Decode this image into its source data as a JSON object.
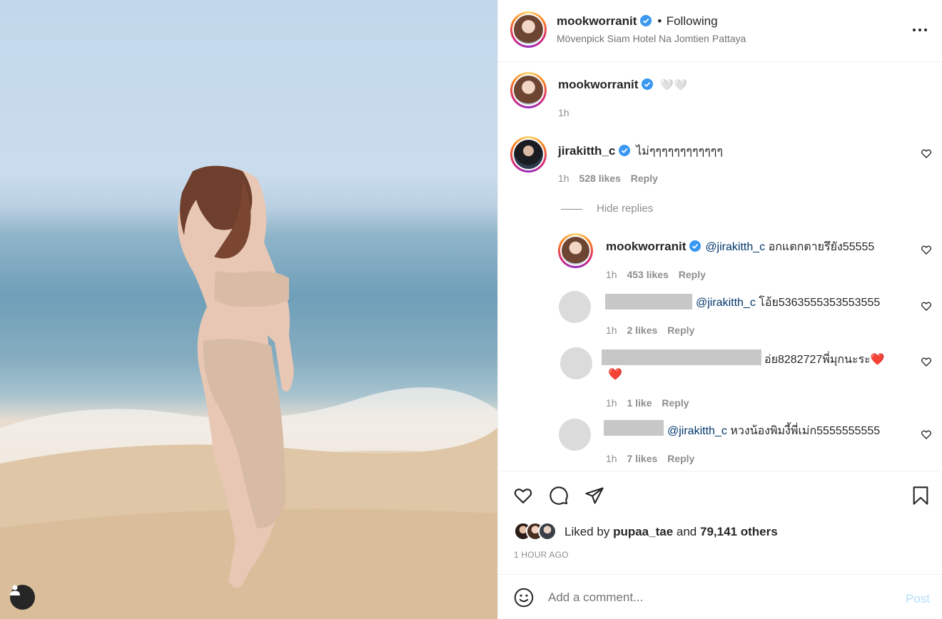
{
  "post": {
    "author": "mookworranit",
    "follow_status": "Following",
    "location": "Mövenpick Siam Hotel Na Jomtien Pattaya",
    "more_icon": "more-horizontal-icon"
  },
  "caption": {
    "username": "mookworranit",
    "text": "🤍🤍",
    "time": "1h"
  },
  "comments": [
    {
      "username": "jirakitth_c",
      "verified": true,
      "text": "ไม่ๆๆๆๆๆๆๆๆๆๆๆๆ",
      "time": "1h",
      "likes": "528 likes",
      "reply": "Reply",
      "hide_replies": "Hide replies",
      "replies": [
        {
          "username": "mookworranit",
          "mention": "@jirakitth_c",
          "text": "อกแตกตายรึยัง55555",
          "time": "1h",
          "likes": "453 likes",
          "reply": "Reply"
        },
        {
          "username": "",
          "mention": "@jirakitth_c",
          "text": "โอ้ย5363555353553555",
          "time": "1h",
          "likes": "2 likes",
          "reply": "Reply"
        },
        {
          "username": "",
          "mention": "",
          "text": "อ่ย8282727พี่มุกนะระ❤️",
          "text2": "❤️",
          "time": "1h",
          "likes": "1 like",
          "reply": "Reply"
        },
        {
          "username": "",
          "mention": "@jirakitth_c",
          "text": "หวงน้องพิมงี้พี่เม่ก5555555555",
          "time": "1h",
          "likes": "7 likes",
          "reply": "Reply"
        }
      ]
    }
  ],
  "liked_by": {
    "prefix": "Liked by",
    "user": "pupaa_tae",
    "and": "and",
    "others": "79,141 others"
  },
  "timestamp": "1 HOUR AGO",
  "add_comment": {
    "placeholder": "Add a comment...",
    "post_label": "Post"
  },
  "colors": {
    "verified": "#3897f0",
    "link": "#00376b",
    "post_disabled": "#b2dffc",
    "heart_red": "#ed4956"
  }
}
